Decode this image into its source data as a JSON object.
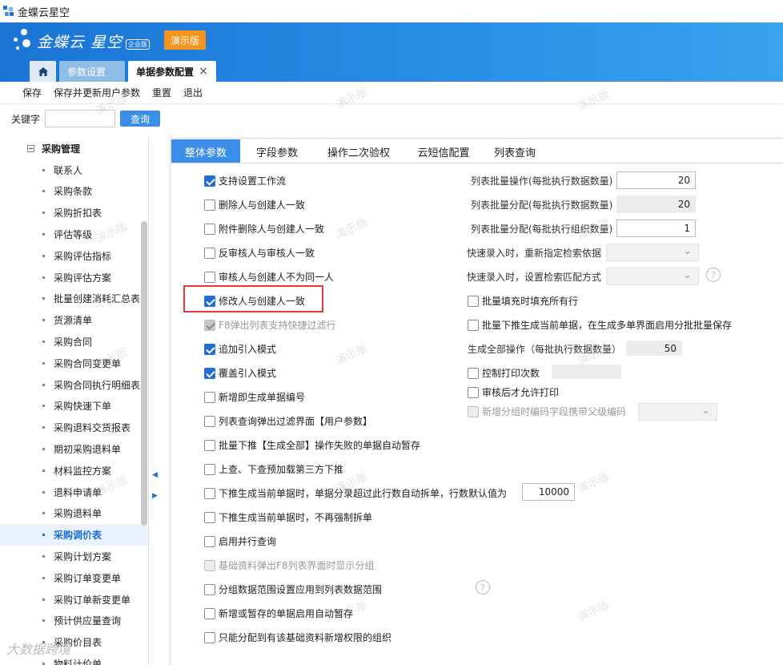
{
  "window": {
    "title": "金蝶云星空"
  },
  "header": {
    "logo_text": "金蝶云 星空",
    "edition": "企业版",
    "demo_label": "演示版",
    "tabs": [
      {
        "label": "参数设置"
      },
      {
        "label": "单据参数配置",
        "close": "×"
      }
    ]
  },
  "toolbar": {
    "items": [
      "保存",
      "保存并更新用户参数",
      "重置",
      "退出"
    ]
  },
  "search": {
    "label": "关键字",
    "value": "",
    "button": "查询"
  },
  "tree": {
    "group": "采购管理",
    "items": [
      "联系人",
      "采购条款",
      "采购折扣表",
      "评估等级",
      "采购评估指标",
      "采购评估方案",
      "批量创建消耗汇总表",
      "货源清单",
      "采购合同",
      "采购合同变更单",
      "采购合同执行明细表",
      "采购快速下单",
      "采购退料交货报表",
      "期初采购退料单",
      "材料监控方案",
      "退料申请单",
      "采购退料单",
      "采购调价表",
      "采购计划方案",
      "采购订单变更单",
      "采购订单新变更单",
      "预计供应量查询",
      "采购价目表",
      "物料计价单"
    ],
    "selected": "采购调价表"
  },
  "panel_tabs": [
    "整体参数",
    "字段参数",
    "操作二次验权",
    "云短信配置",
    "列表查询"
  ],
  "left_options": [
    {
      "label": "支持设置工作流",
      "checked": true,
      "disabled": false
    },
    {
      "label": "删除人与创建人一致",
      "checked": false,
      "disabled": false
    },
    {
      "label": "附件删除人与创建人一致",
      "checked": false,
      "disabled": false
    },
    {
      "label": "反审核人与审核人一致",
      "checked": false,
      "disabled": false
    },
    {
      "label": "审核人与创建人不为同一人",
      "checked": false,
      "disabled": false
    },
    {
      "label": "修改人与创建人一致",
      "checked": true,
      "disabled": false
    },
    {
      "label": "F8弹出列表支持快捷过滤行",
      "checked": true,
      "disabled": true
    },
    {
      "label": "追加引入模式",
      "checked": true,
      "disabled": false
    },
    {
      "label": "覆盖引入模式",
      "checked": true,
      "disabled": false
    },
    {
      "label": "新增即生成单据编号",
      "checked": false,
      "disabled": false
    },
    {
      "label": "列表查询弹出过滤界面【用户参数】",
      "checked": false,
      "disabled": false
    },
    {
      "label": "批量下推【生成全部】操作失败的单据自动暂存",
      "checked": false,
      "disabled": false
    },
    {
      "label": "上查、下查预加载第三方下推",
      "checked": false,
      "disabled": false
    },
    {
      "label": "下推生成当前单据时，单据分录超过此行数自动拆单，行数默认值为",
      "checked": false,
      "disabled": false
    },
    {
      "label": "下推生成当前单据时，不再强制拆单",
      "checked": false,
      "disabled": false
    },
    {
      "label": "启用并行查询",
      "checked": false,
      "disabled": false
    },
    {
      "label": "基础资料弹出F8列表界面时显示分组",
      "checked": false,
      "disabled": true
    },
    {
      "label": "分组数据范围设置应用到列表数据范围",
      "checked": false,
      "disabled": false
    },
    {
      "label": "新增或暂存的单据启用自动暂存",
      "checked": false,
      "disabled": false
    },
    {
      "label": "只能分配到有该基础资料新增权限的组织",
      "checked": false,
      "disabled": false
    }
  ],
  "split_rows_value": "10000",
  "right_fields": [
    {
      "label": "列表批量操作(每批执行数据数量)",
      "value": "20"
    },
    {
      "label": "列表批量分配(每批执行数据数量)",
      "value": "20"
    },
    {
      "label": "列表批量分配(每批执行组织数量)",
      "value": "1"
    },
    {
      "label": "快速录入时，重新指定检索依据",
      "value": ""
    },
    {
      "label": "快速录入时，设置检索匹配方式",
      "value": ""
    }
  ],
  "right_options": [
    {
      "label": "批量填充时填充所有行",
      "checked": false,
      "disabled": false
    },
    {
      "label": "批量下推生成当前单据，在生成多单界面启用分批批量保存",
      "checked": false,
      "disabled": false
    }
  ],
  "generate_all": {
    "label": "生成全部操作（每批执行数据数量）",
    "value": "50"
  },
  "right_options2": [
    {
      "label": "控制打印次数",
      "checked": false,
      "disabled": false
    },
    {
      "label": "审核后才允许打印",
      "checked": false,
      "disabled": false
    },
    {
      "label": "新增分组时编码字段携带父级编码",
      "checked": false,
      "disabled": true
    }
  ],
  "help_icon": "?",
  "watermark_text": "演示版",
  "brand_watermark": "大数据跨境",
  "colors": {
    "accent": "#3b8ee8",
    "header": "#1a74d4",
    "demo": "#f7941d",
    "highlight": "#e53935"
  }
}
